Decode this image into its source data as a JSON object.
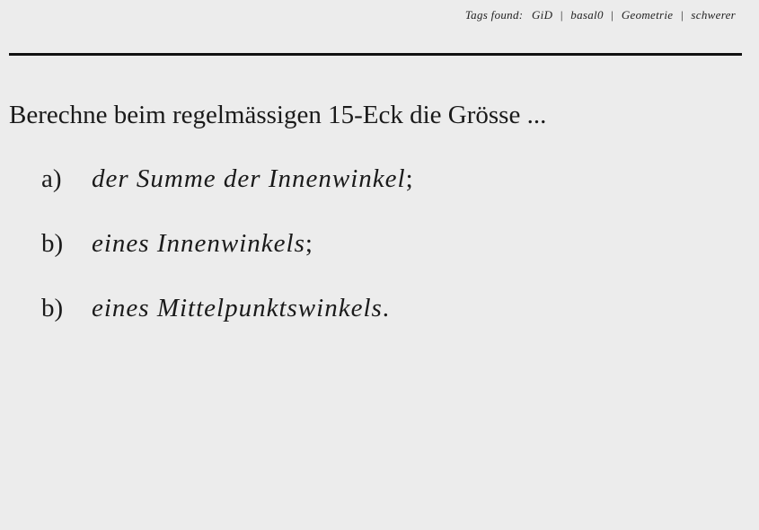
{
  "header": {
    "tags_label": "Tags found:",
    "tags": [
      "GiD",
      "basal0",
      "Geometrie",
      "schwerer"
    ]
  },
  "question": {
    "prompt": "Berechne beim regelmässigen 15-Eck die Grösse ...",
    "items": [
      {
        "marker": "a)",
        "text": "der Summe der Innenwinkel",
        "punct": ";"
      },
      {
        "marker": "b)",
        "text": "eines Innenwinkels",
        "punct": ";"
      },
      {
        "marker": "b)",
        "text": "eines Mittelpunktswinkels",
        "punct": "."
      }
    ]
  }
}
